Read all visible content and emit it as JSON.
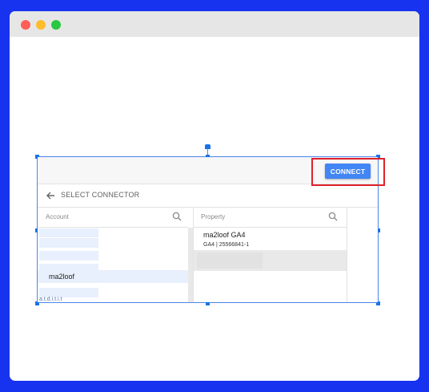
{
  "window": {
    "controls": [
      "close",
      "minimize",
      "zoom"
    ],
    "colors": {
      "close": "#fe5f57",
      "minimize": "#febc2e",
      "zoom": "#28c840",
      "background": "#1733f0"
    }
  },
  "dialog": {
    "connect_label": "CONNECT",
    "header_title": "SELECT CONNECTOR",
    "back_icon": "arrow-left-icon",
    "account": {
      "column_label": "Account",
      "search_icon": "search-icon",
      "selected_item": "ma2loof",
      "cut_off_text": "a.t.d.i.t.i.t"
    },
    "property": {
      "column_label": "Property",
      "search_icon": "search-icon",
      "item_title": "ma2loof GA4",
      "item_subtitle": "GA4 | 25566841-1"
    },
    "accent_color": "#4285f4",
    "highlight_color": "#e0202a"
  }
}
